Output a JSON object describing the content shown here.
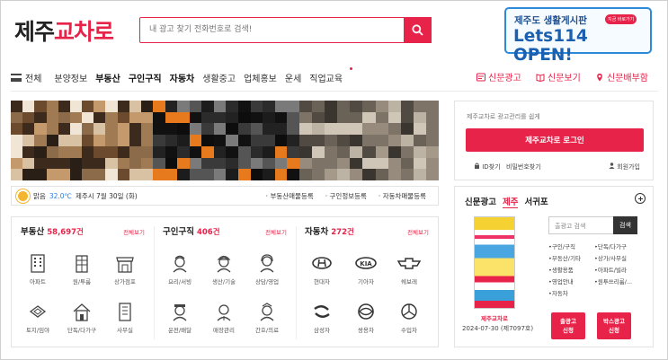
{
  "header": {
    "logo_part1": "제주",
    "logo_part2": "교차로",
    "search_placeholder": "내 광고 찾기 전화번호로 검색!",
    "banner_line1": "제주도 생활게시판",
    "banner_badge": "지금 바로가기",
    "banner_line2": "Lets114 OPEN!"
  },
  "nav": {
    "all_label": "전체",
    "items": [
      "분양정보",
      "부동산",
      "구인구직",
      "자동차",
      "생활중고",
      "업체홍보",
      "운세",
      "직업교육"
    ],
    "right_links": [
      "신문광고",
      "신문보기",
      "신문배부함"
    ]
  },
  "weather": {
    "condition": "맑음",
    "temperature": "32.0℃",
    "date_text": "제주시 7월 30일 (화)",
    "register_links": [
      "· 부동산매물등록",
      "· 구인정보등록",
      "· 자동차매물등록"
    ]
  },
  "categories": [
    {
      "title": "부동산",
      "count": "58,697건",
      "more": "전체보기",
      "items": [
        "아파트",
        "원/투룸",
        "상가점포",
        "토지/임야",
        "단독/다가구",
        "사무실"
      ]
    },
    {
      "title": "구인구직",
      "count": "406건",
      "more": "전체보기",
      "items": [
        "요리/서빙",
        "생산/기술",
        "상담/영업",
        "운전/배달",
        "매장관리",
        "간호/의료"
      ]
    },
    {
      "title": "자동차",
      "count": "272건",
      "more": "전체보기",
      "items": [
        "현대자",
        "기아자",
        "쉐보레",
        "삼성자",
        "쌍용차",
        "수입차"
      ]
    }
  ],
  "login": {
    "title": "제주교차로 광고관리를 쉽게",
    "button": "제주교차로 로그인",
    "find_id": "ID찾기",
    "find_pw": "비밀번호찾기",
    "join": "회원가입"
  },
  "paper": {
    "tabs": [
      "신문광고",
      "제주",
      "서귀포"
    ],
    "name": "제주교차로",
    "date": "2024-07-30 (제7097호)",
    "search_placeholder": "출광고 검색",
    "search_button": "검색",
    "links_col1": [
      "•구인/구직",
      "•부동산/기타",
      "•생활용품",
      "•영업안내",
      "•자동차"
    ],
    "links_col2": [
      "•단독/다가구",
      "•상가/사무실",
      "•아파트/빌라",
      "•원투쓰리룸/..."
    ],
    "button1": "출광고\n신청",
    "button2": "박스광고\n신청"
  },
  "colors": {
    "accent": "#e8234a",
    "weather_temp": "#2b7de0",
    "banner": "#1a5fb0"
  }
}
